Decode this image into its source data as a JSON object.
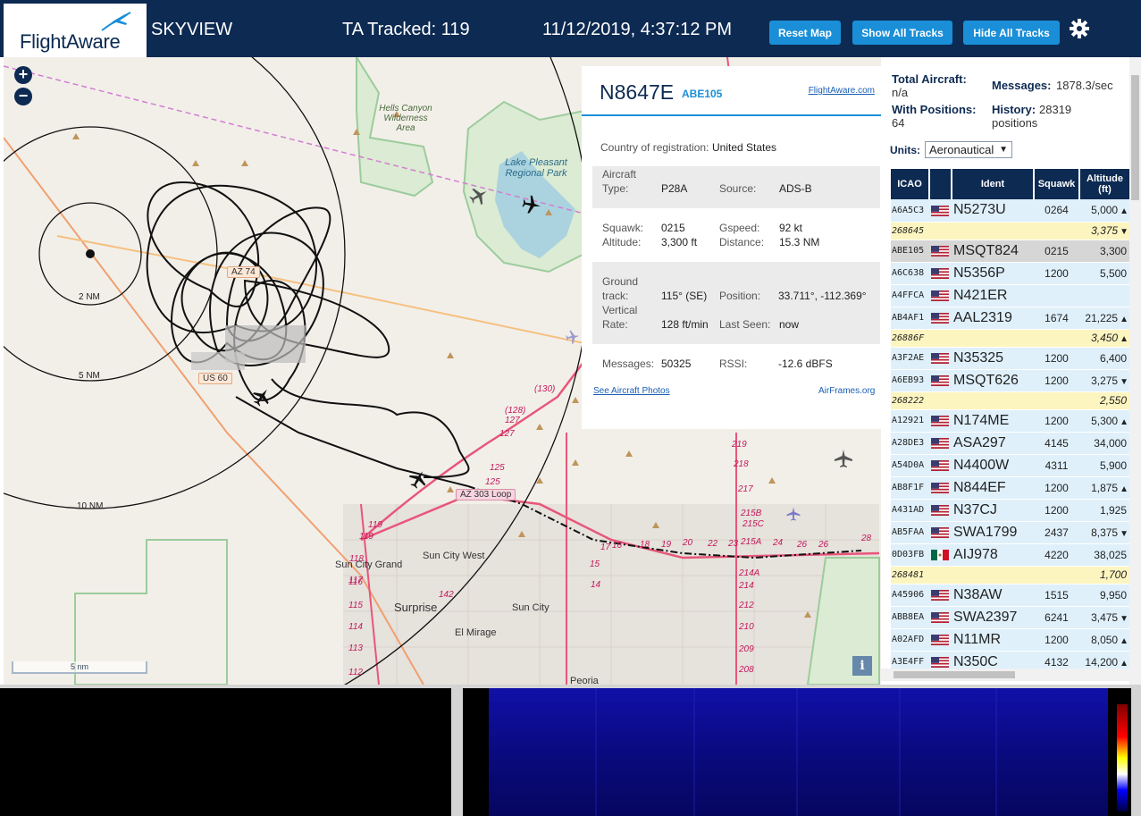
{
  "header": {
    "logo_text": "FlightAware",
    "app_name": "SKYVIEW",
    "tracked_label": "TA Tracked: 119",
    "datetime": "11/12/2019, 4:37:12 PM",
    "buttons": {
      "reset_map": "Reset Map",
      "show_all": "Show All Tracks",
      "hide_all": "Hide All Tracks"
    },
    "settings_icon": "gear-icon"
  },
  "map": {
    "zoom_in": "+",
    "zoom_out": "−",
    "scale_label": "5 nm",
    "info_button": "i",
    "range_rings": [
      "2 NM",
      "5 NM",
      "10 NM"
    ],
    "labels": {
      "wilderness": "Hells Canyon Wilderness Area",
      "lake": "Lake Pleasant Regional Park",
      "sun_city_grand": "Sun City Grand",
      "sun_city_west": "Sun City West",
      "surprise": "Surprise",
      "sun_city": "Sun City",
      "el_mirage": "El Mirage",
      "peoria": "Peoria"
    },
    "shields": {
      "az74": "AZ 74",
      "us60": "US 60",
      "az303": "AZ 303 Loop"
    },
    "route_numbers": [
      "(130)",
      "(128)",
      "127",
      "127",
      "125",
      "125",
      "219",
      "218",
      "217",
      "215B",
      "215A",
      "215C",
      "214A",
      "214",
      "212",
      "210",
      "209",
      "208",
      "17",
      "16",
      "18",
      "19",
      "20",
      "22",
      "23",
      "24",
      "26",
      "26",
      "28",
      "119",
      "119",
      "118",
      "117",
      "116",
      "115",
      "114",
      "113",
      "112",
      "142",
      "14",
      "15"
    ],
    "colors": {
      "track": "#111111",
      "ring": "#111111",
      "highway": "#e8567a",
      "park_border": "#9ccc9c",
      "water": "#aad3df"
    }
  },
  "selected": {
    "ident": "N8647E",
    "callsign": "ABE105",
    "fa_link": "FlightAware.com",
    "country_label": "Country of registration:",
    "country_value": "United States",
    "aircraft_type_label_1": "Aircraft",
    "aircraft_type_label_2": "Type:",
    "aircraft_type": "P28A",
    "source_label": "Source:",
    "source": "ADS-B",
    "squawk_label": "Squawk:",
    "squawk": "0215",
    "gspeed_label": "Gspeed:",
    "gspeed": "92 kt",
    "altitude_label": "Altitude:",
    "altitude": "3,300 ft",
    "distance_label": "Distance:",
    "distance": "15.3 NM",
    "ground_track_label_1": "Ground",
    "ground_track_label_2": "track:",
    "ground_track": "115° (SE)",
    "position_label": "Position:",
    "position": "33.711°, -112.369°",
    "vrate_label_1": "Vertical",
    "vrate_label_2": "Rate:",
    "vrate": "128 ft/min",
    "last_seen_label": "Last Seen:",
    "last_seen": "now",
    "messages_label": "Messages:",
    "messages": "50325",
    "rssi_label": "RSSI:",
    "rssi": "-12.6 dBFS",
    "photos_link": "See Aircraft Photos",
    "airframes_link": "AirFrames.org"
  },
  "stats": {
    "total_label": "Total Aircraft:",
    "total_value": "n/a",
    "messages_label": "Messages:",
    "messages_value": "1878.3/sec",
    "positions_label": "With Positions:",
    "positions_value": "64",
    "history_label": "History:",
    "history_value": "28319",
    "history_unit": "positions",
    "units_label": "Units:",
    "units_value": "Aeronautical"
  },
  "table": {
    "headers": [
      "ICAO",
      "",
      "Ident",
      "Squawk",
      "Altitude (ft)"
    ],
    "rows": [
      {
        "icao": "A6A5C3",
        "flag": "us",
        "ident": "N5273U",
        "squawk": "0264",
        "alt": "5,000",
        "trend": "▲",
        "style": "blue"
      },
      {
        "icao": "268645",
        "flag": "",
        "ident": "",
        "squawk": "",
        "alt": "3,375",
        "trend": "▼",
        "style": "yel"
      },
      {
        "icao": "ABE105",
        "flag": "us",
        "ident": "MSQT824",
        "squawk": "0215",
        "alt": "3,300",
        "trend": "",
        "style": "sel"
      },
      {
        "icao": "A6C638",
        "flag": "us",
        "ident": "N5356P",
        "squawk": "1200",
        "alt": "5,500",
        "trend": "",
        "style": "blue"
      },
      {
        "icao": "A4FFCA",
        "flag": "us",
        "ident": "N421ER",
        "squawk": "",
        "alt": "",
        "trend": "",
        "style": "blue"
      },
      {
        "icao": "AB4AF1",
        "flag": "us",
        "ident": "AAL2319",
        "squawk": "1674",
        "alt": "21,225",
        "trend": "▲",
        "style": "blue"
      },
      {
        "icao": "26886F",
        "flag": "",
        "ident": "",
        "squawk": "",
        "alt": "3,450",
        "trend": "▲",
        "style": "yel"
      },
      {
        "icao": "A3F2AE",
        "flag": "us",
        "ident": "N35325",
        "squawk": "1200",
        "alt": "6,400",
        "trend": "",
        "style": "blue"
      },
      {
        "icao": "A6EB93",
        "flag": "us",
        "ident": "MSQT626",
        "squawk": "1200",
        "alt": "3,275",
        "trend": "▼",
        "style": "blue"
      },
      {
        "icao": "268222",
        "flag": "",
        "ident": "",
        "squawk": "",
        "alt": "2,550",
        "trend": "",
        "style": "yel"
      },
      {
        "icao": "A12921",
        "flag": "us",
        "ident": "N174ME",
        "squawk": "1200",
        "alt": "5,300",
        "trend": "▲",
        "style": "blue"
      },
      {
        "icao": "A28DE3",
        "flag": "us",
        "ident": "ASA297",
        "squawk": "4145",
        "alt": "34,000",
        "trend": "",
        "style": "blue"
      },
      {
        "icao": "A54D0A",
        "flag": "us",
        "ident": "N4400W",
        "squawk": "4311",
        "alt": "5,900",
        "trend": "",
        "style": "blue"
      },
      {
        "icao": "AB8F1F",
        "flag": "us",
        "ident": "N844EF",
        "squawk": "1200",
        "alt": "1,875",
        "trend": "▲",
        "style": "blue"
      },
      {
        "icao": "A431AD",
        "flag": "us",
        "ident": "N37CJ",
        "squawk": "1200",
        "alt": "1,925",
        "trend": "",
        "style": "blue"
      },
      {
        "icao": "AB5FAA",
        "flag": "us",
        "ident": "SWA1799",
        "squawk": "2437",
        "alt": "8,375",
        "trend": "▼",
        "style": "blue"
      },
      {
        "icao": "0D03FB",
        "flag": "mx",
        "ident": "AIJ978",
        "squawk": "4220",
        "alt": "38,025",
        "trend": "",
        "style": "blue"
      },
      {
        "icao": "268481",
        "flag": "",
        "ident": "",
        "squawk": "",
        "alt": "1,700",
        "trend": "",
        "style": "yel"
      },
      {
        "icao": "A45906",
        "flag": "us",
        "ident": "N38AW",
        "squawk": "1515",
        "alt": "9,950",
        "trend": "",
        "style": "blue"
      },
      {
        "icao": "ABB8EA",
        "flag": "us",
        "ident": "SWA2397",
        "squawk": "6241",
        "alt": "3,475",
        "trend": "▼",
        "style": "blue"
      },
      {
        "icao": "A02AFD",
        "flag": "us",
        "ident": "N11MR",
        "squawk": "1200",
        "alt": "8,050",
        "trend": "▲",
        "style": "blue"
      },
      {
        "icao": "A3E4FF",
        "flag": "us",
        "ident": "N350C",
        "squawk": "4132",
        "alt": "14,200",
        "trend": "▲",
        "style": "blue"
      }
    ]
  }
}
